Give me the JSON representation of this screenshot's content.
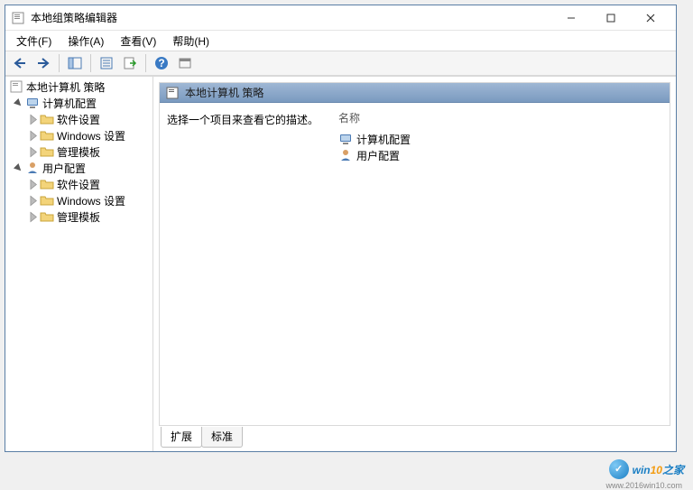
{
  "window": {
    "title": "本地组策略编辑器"
  },
  "menu": {
    "file": "文件(F)",
    "action": "操作(A)",
    "view": "查看(V)",
    "help": "帮助(H)"
  },
  "tree": {
    "root": "本地计算机 策略",
    "computer_config": "计算机配置",
    "user_config": "用户配置",
    "software_settings": "软件设置",
    "windows_settings": "Windows 设置",
    "admin_templates": "管理模板"
  },
  "content": {
    "header": "本地计算机 策略",
    "description": "选择一个项目来查看它的描述。",
    "col_name": "名称",
    "items": {
      "computer": "计算机配置",
      "user": "用户配置"
    }
  },
  "tabs": {
    "extended": "扩展",
    "standard": "标准"
  },
  "watermark": {
    "brand_a": "win",
    "brand_b": "10",
    "brand_c": "之家",
    "url": "www.2016win10.com"
  }
}
